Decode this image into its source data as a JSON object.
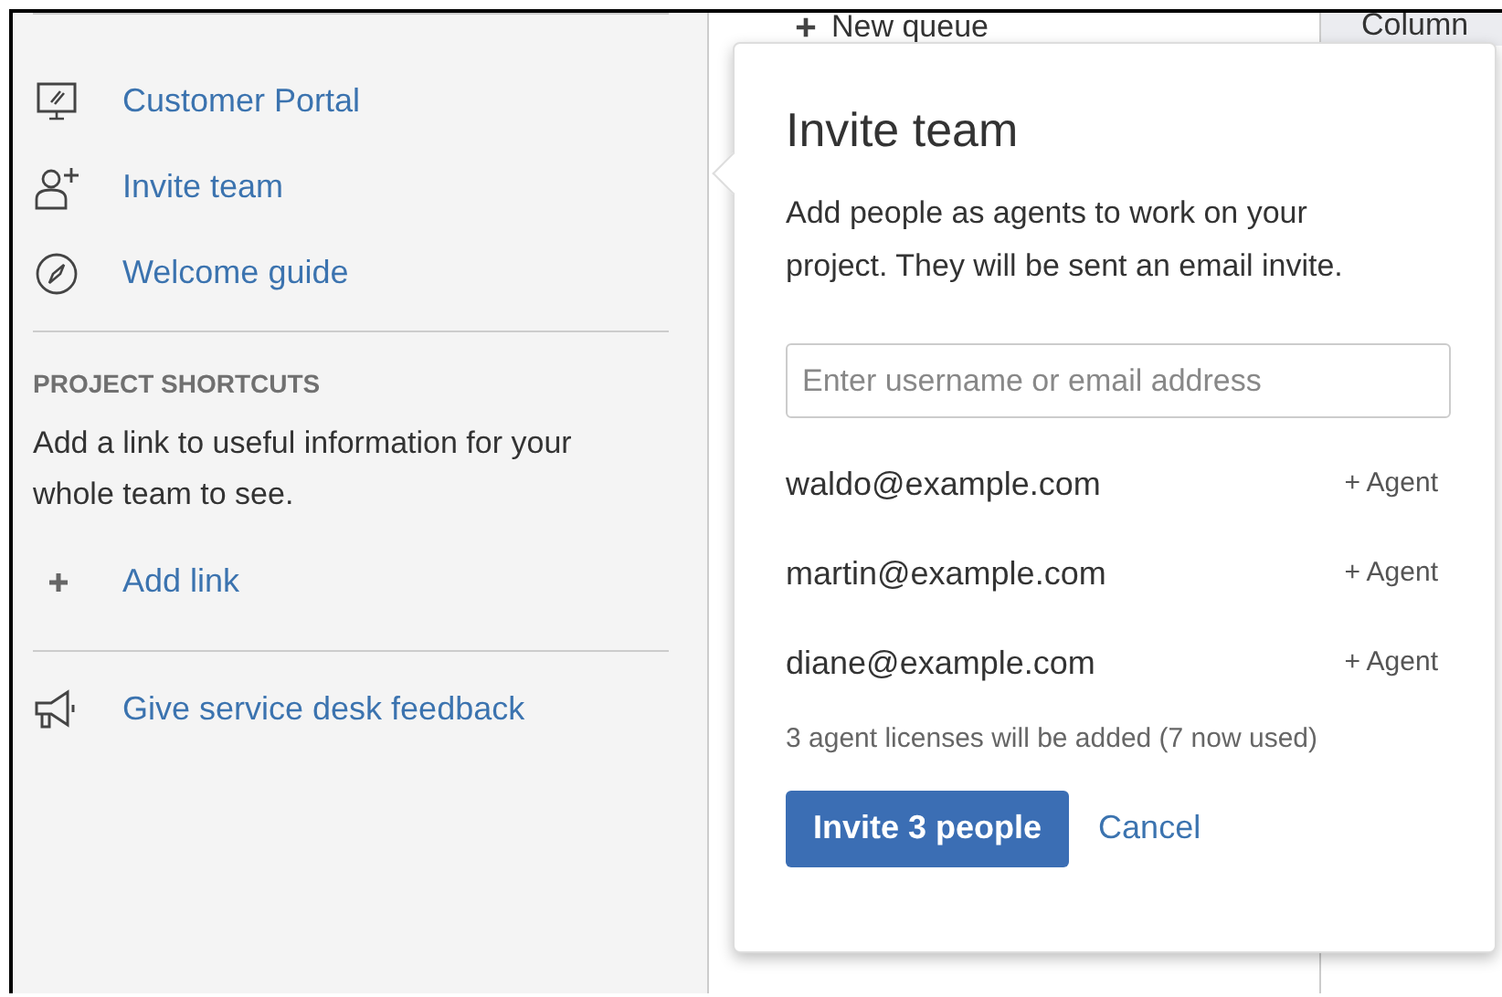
{
  "sidebar": {
    "nav_items": [
      {
        "kind": "portal",
        "label": "Customer Portal"
      },
      {
        "kind": "invite",
        "label": "Invite team"
      },
      {
        "kind": "guide",
        "label": "Welcome guide"
      }
    ],
    "shortcuts": {
      "heading": "PROJECT SHORTCUTS",
      "description": "Add a link to useful information for your whole team to see.",
      "add_link": "Add link"
    },
    "feedback": {
      "label": "Give service desk feedback"
    }
  },
  "main": {
    "new_queue": "New queue",
    "columns_tab": "Column"
  },
  "invite_dialog": {
    "title": "Invite team",
    "description": "Add people as agents to work on your project. They will be sent an email invite.",
    "search": {
      "placeholder": "Enter username or email address"
    },
    "invitees": [
      {
        "email": "waldo@example.com",
        "role": "+ Agent"
      },
      {
        "email": "martin@example.com",
        "role": "+ Agent"
      },
      {
        "email": "diane@example.com",
        "role": "+ Agent"
      }
    ],
    "license_note": "3 agent licenses will be added (7 now used)",
    "buttons": {
      "primary": "Invite 3 people",
      "cancel": "Cancel"
    }
  }
}
